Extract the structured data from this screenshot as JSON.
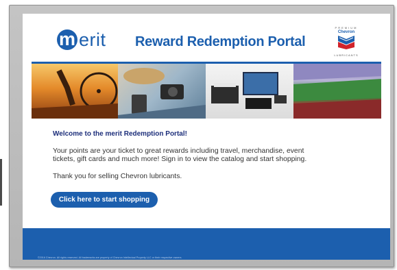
{
  "header": {
    "logo_letter": "m",
    "logo_word": "erit",
    "title": "Reward Redemption Portal",
    "chevron": {
      "top_text": "PREMIUM",
      "name": "Chevron",
      "bottom_text": "LUBRICANTS"
    }
  },
  "banner": {
    "images": [
      "cyclist-photo",
      "travel-items-photo",
      "electronics-photo",
      "stadium-photo"
    ]
  },
  "content": {
    "welcome": "Welcome to the merit Redemption Portal!",
    "body": "Your points are your ticket to great rewards including travel, merchandise, event tickets, gift cards and much more! Sign in to view the catalog and start shopping.",
    "thanks": "Thank you for selling Chevron lubricants.",
    "cta_label": "Click here to start shopping"
  },
  "footer": {
    "text": "©2016 Chevron. All rights reserved. All trademarks are property of Chevron Intellectual Property LLC or their respective owners."
  },
  "colors": {
    "brand_blue": "#1c5fae",
    "chevron_red": "#d1232a",
    "frame_gray": "#bdbdbd"
  }
}
